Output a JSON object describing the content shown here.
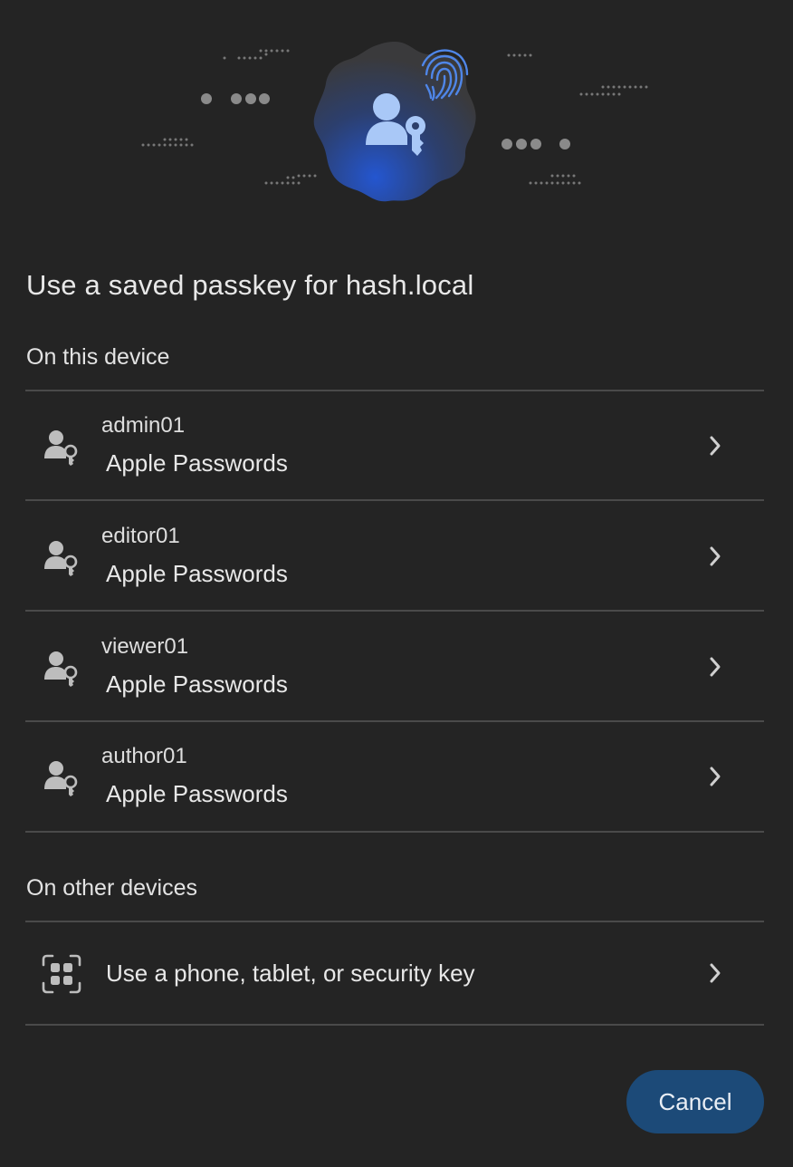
{
  "dialog": {
    "title": "Use a saved passkey for hash.local",
    "on_device_label": "On this device",
    "other_devices_label": "On other devices"
  },
  "hero": {
    "illustration_icons": [
      "person-key-icon",
      "fingerprint-icon"
    ],
    "accent_color": "#2d57c4"
  },
  "accounts": [
    {
      "username": "admin01",
      "provider": "Apple Passwords",
      "icon": "person-key-icon"
    },
    {
      "username": "editor01",
      "provider": "Apple Passwords",
      "icon": "person-key-icon"
    },
    {
      "username": "viewer01",
      "provider": "Apple Passwords",
      "icon": "person-key-icon"
    },
    {
      "username": "author01",
      "provider": "Apple Passwords",
      "icon": "person-key-icon"
    }
  ],
  "other_option": {
    "label": "Use a phone, tablet, or security key",
    "icon": "qr-code-icon"
  },
  "buttons": {
    "cancel": "Cancel"
  },
  "colors": {
    "background": "#242424",
    "divider": "#4a4a4a",
    "cancel_button": "#1c4a78"
  }
}
